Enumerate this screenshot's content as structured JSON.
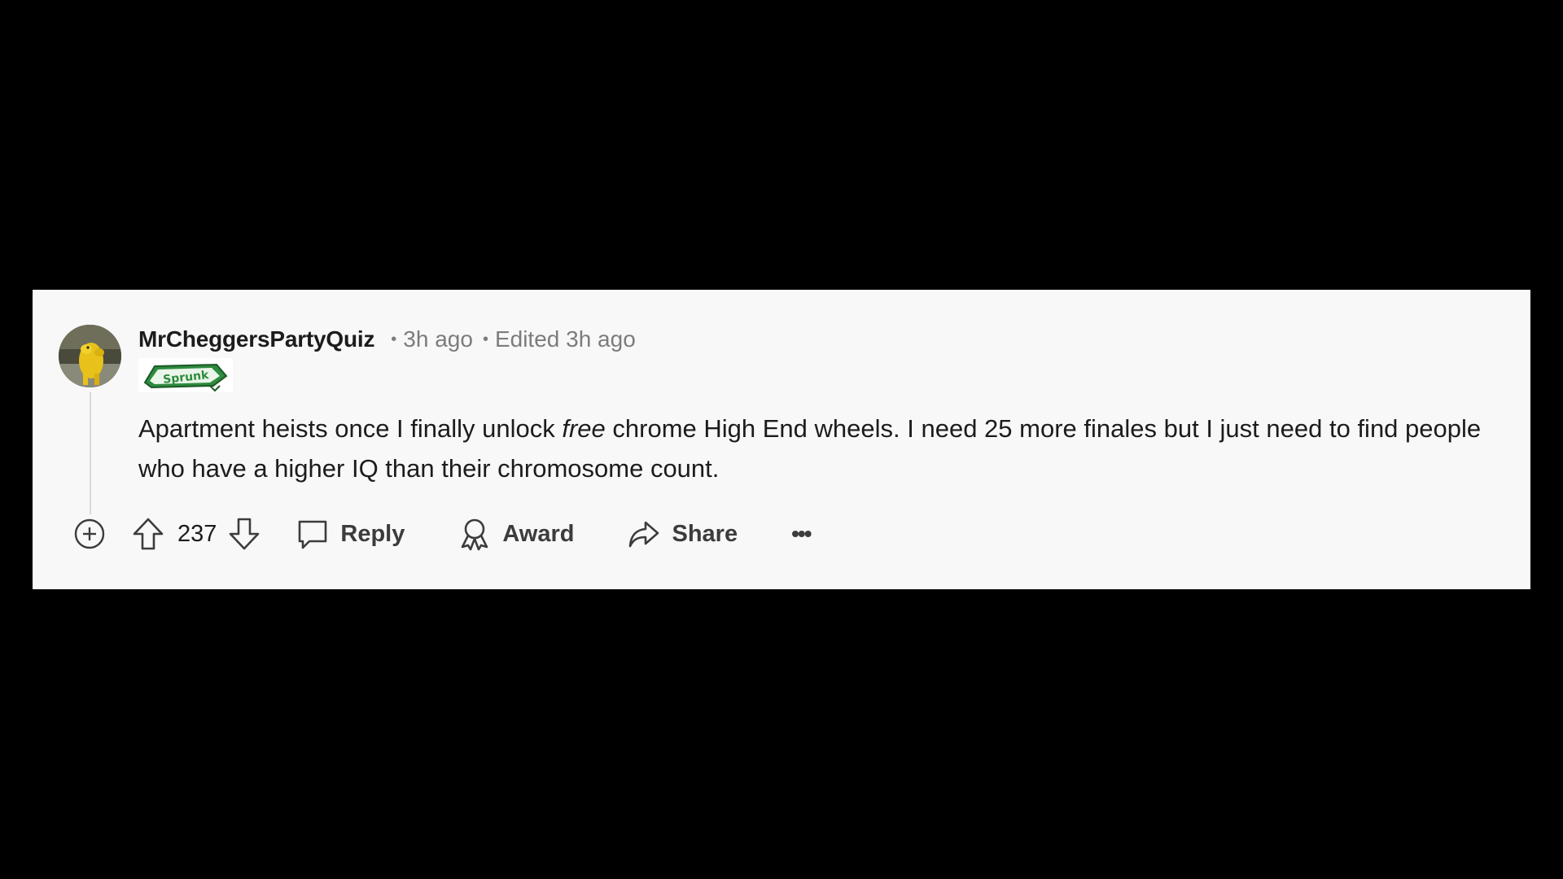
{
  "comment": {
    "username": "MrCheggersPartyQuiz",
    "separator": "•",
    "posted": "3h ago",
    "edited": "Edited 3h ago",
    "flair_text": "Sprunk",
    "body_before": "Apartment heists once I finally unlock ",
    "body_emphasis": "free",
    "body_after": " chrome High End wheels. I need 25 more finales but I just need to find people who have a higher IQ than their chromosome count."
  },
  "actions": {
    "score": "237",
    "reply_label": "Reply",
    "award_label": "Award",
    "share_label": "Share",
    "more_label": "•••"
  },
  "icons": {
    "expand": "plus-circle-icon",
    "upvote": "arrow-up-icon",
    "downvote": "arrow-down-icon",
    "reply": "comment-bubble-icon",
    "award": "award-ribbon-icon",
    "share": "share-arrow-icon",
    "more": "ellipsis-icon"
  },
  "colors": {
    "card_background": "#f8f8f8",
    "page_background": "#000000",
    "text_primary": "#1c1c1c",
    "text_meta": "#7c7c7c",
    "flair_green": "#2e8b3e"
  }
}
